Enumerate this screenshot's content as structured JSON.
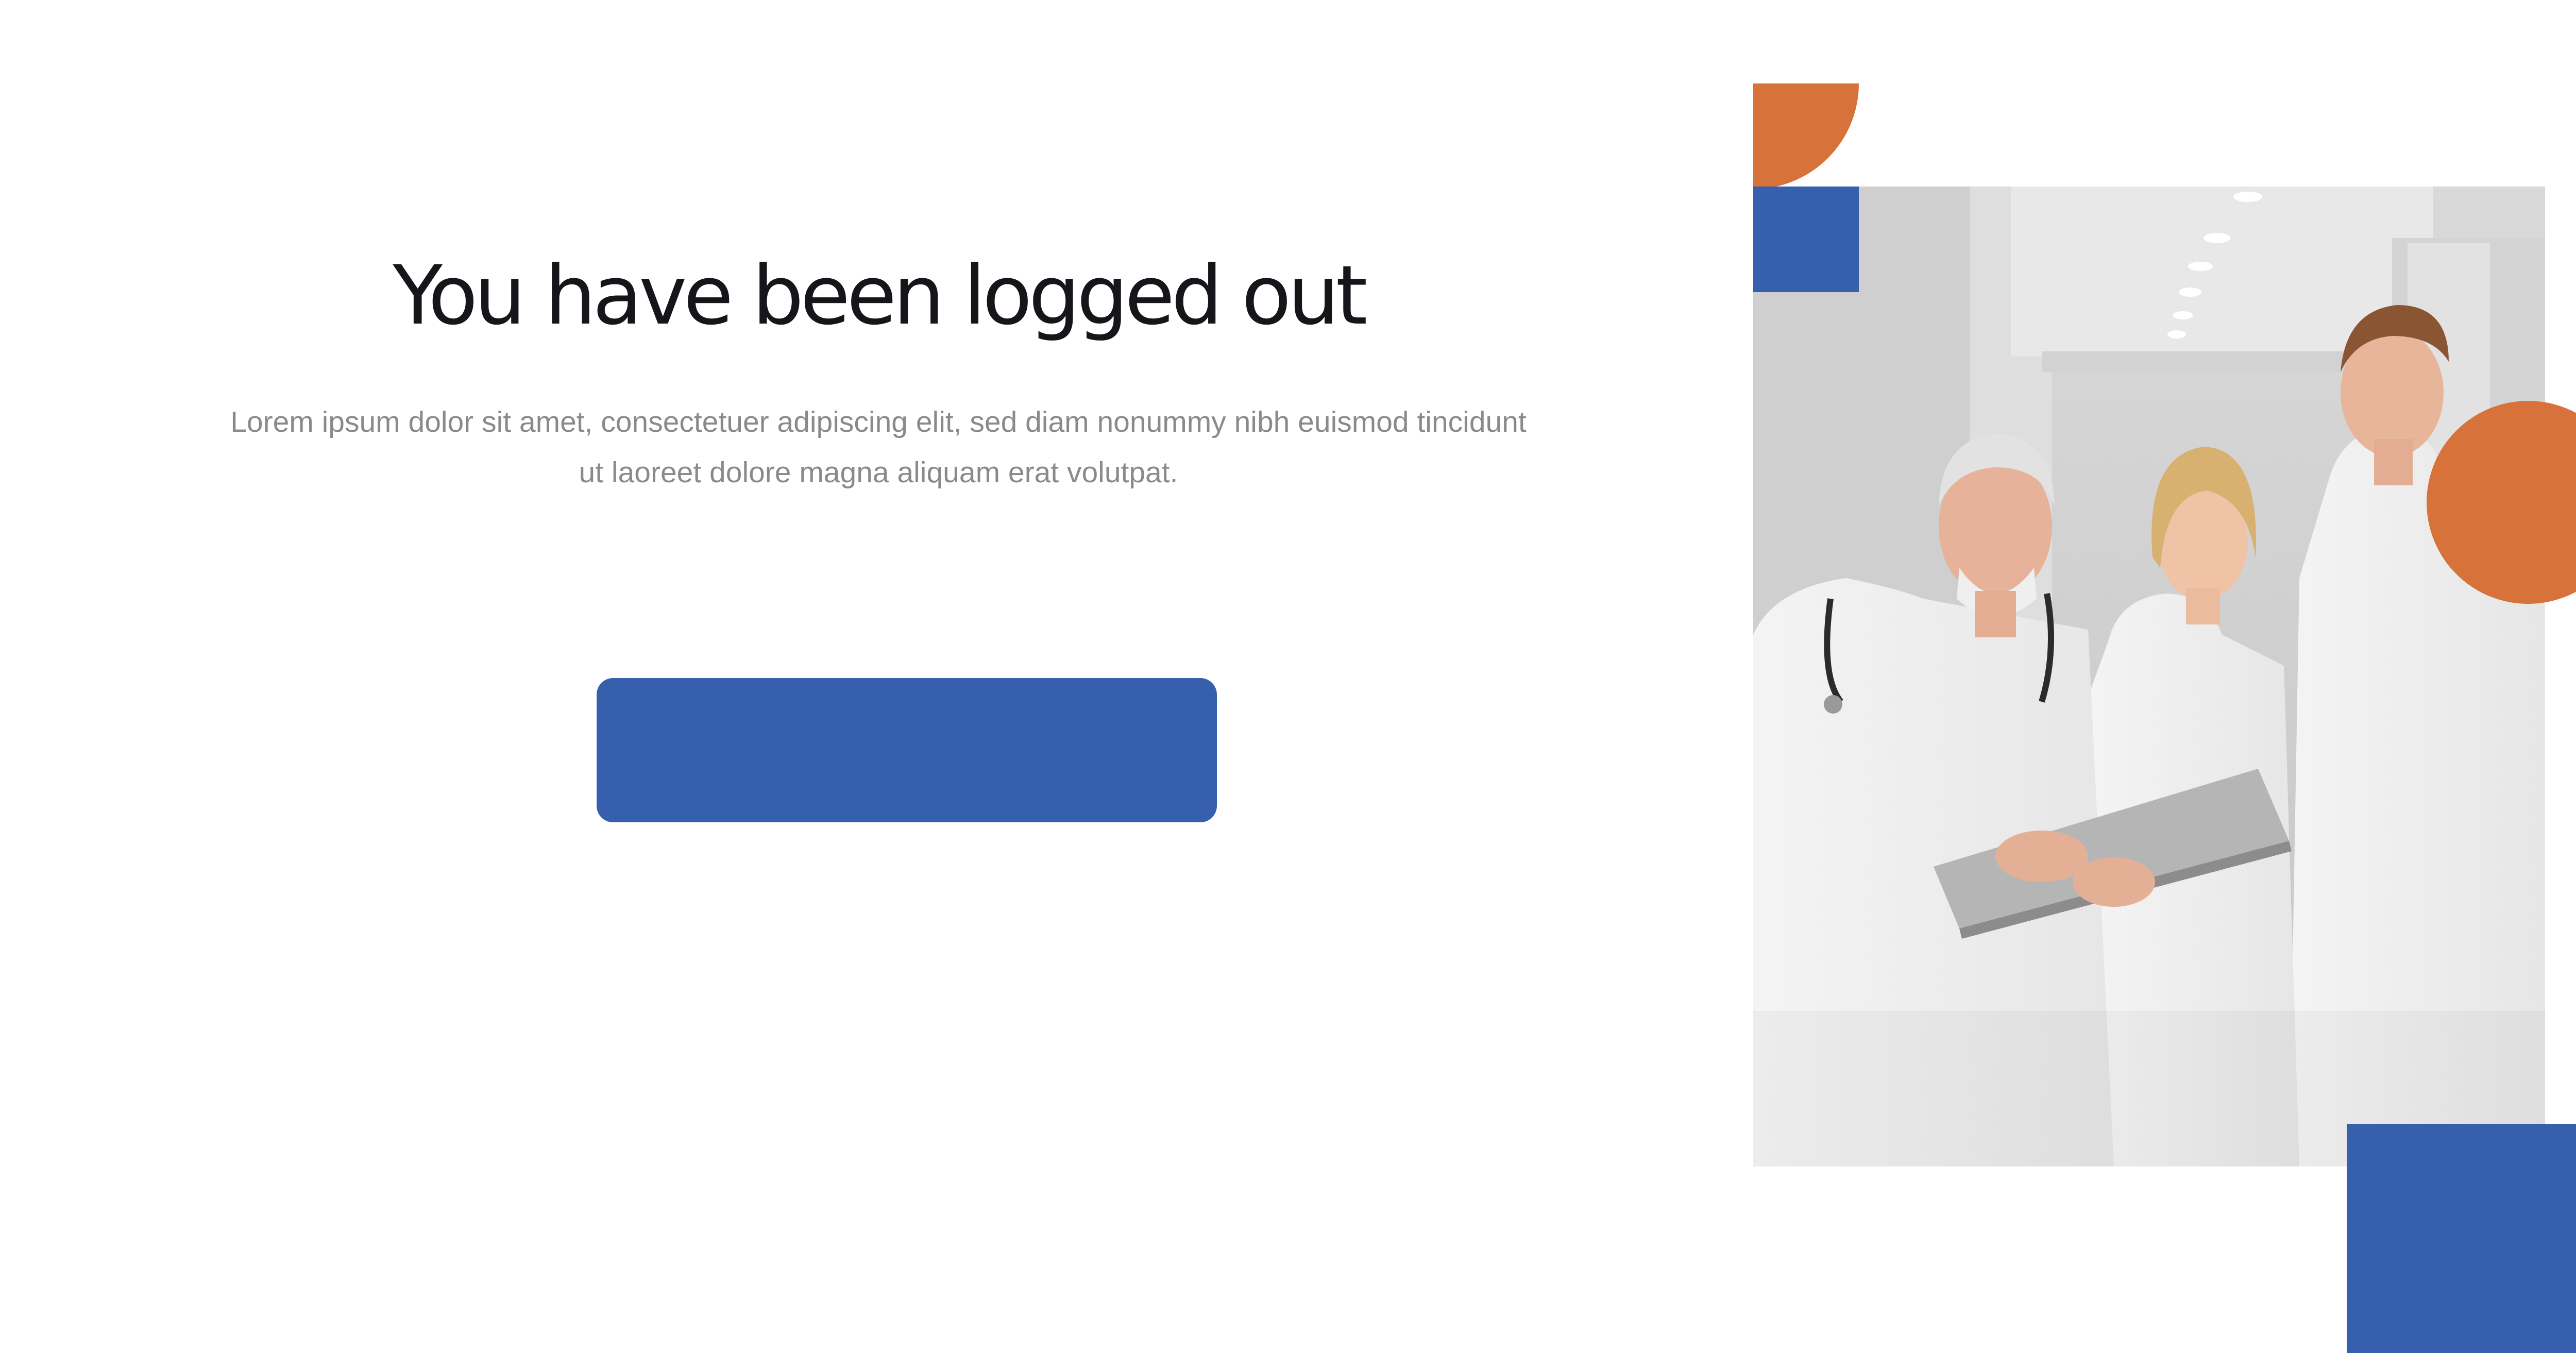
{
  "logout": {
    "title": "You have been logged out",
    "message": "Lorem ipsum dolor sit amet, consectetuer adipiscing elit, sed diam nonummy nibh euismod tincidunt ut laoreet dolore magna aliquam erat volutpat.",
    "button_label": ""
  },
  "colors": {
    "primary_blue": "#3660ae",
    "accent_orange": "#d7733a",
    "heading_text": "#14161a",
    "body_text": "#8a8a8a",
    "background": "#ffffff"
  },
  "photo": {
    "subject": "three-medical-staff-with-laptop"
  }
}
